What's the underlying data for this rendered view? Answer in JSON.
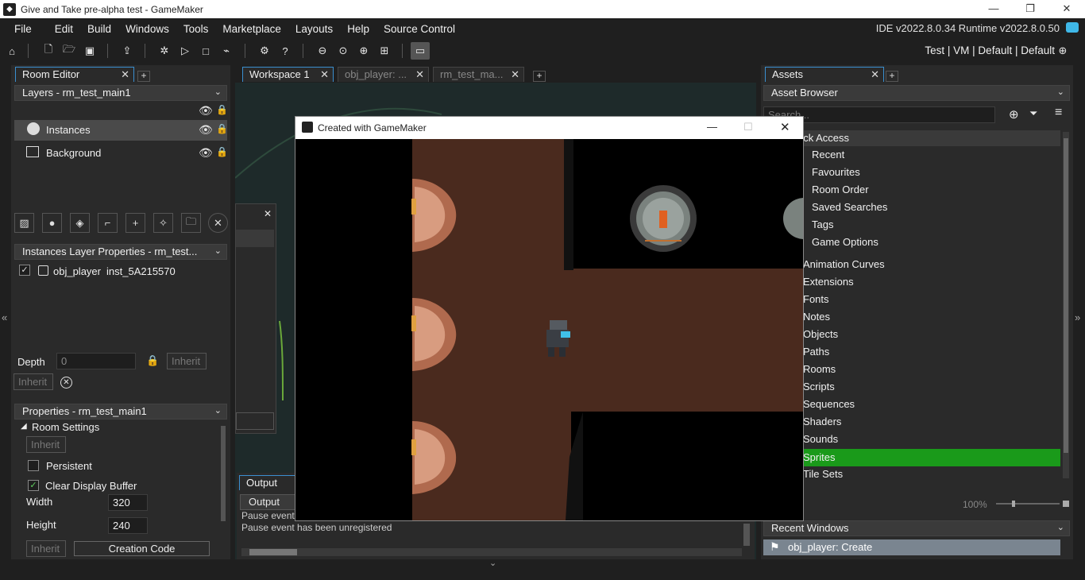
{
  "window": {
    "title": "Give and Take pre-alpha test - GameMaker",
    "min": "—",
    "max": "❐",
    "close": "✕"
  },
  "menu": [
    "File",
    "Edit",
    "Build",
    "Windows",
    "Tools",
    "Marketplace",
    "Layouts",
    "Help",
    "Source Control"
  ],
  "version": "IDE v2022.8.0.34  Runtime v2022.8.0.50",
  "target_config": "Test | VM | Default | Default",
  "room_editor": {
    "tab": "Room Editor",
    "layers_header": "Layers - rm_test_main1",
    "layers": [
      {
        "name": "Instances"
      },
      {
        "name": "Background"
      }
    ],
    "instances_header": "Instances Layer Properties - rm_test...",
    "instance": {
      "object": "obj_player",
      "id": "inst_5A215570"
    },
    "depth_label": "Depth",
    "depth_value": "0",
    "inherit": "Inherit"
  },
  "properties": {
    "header": "Properties - rm_test_main1",
    "section": "Room Settings",
    "inherit": "Inherit",
    "persistent": "Persistent",
    "clear_display_buffer": "Clear Display Buffer",
    "width_label": "Width",
    "width_value": "320",
    "height_label": "Height",
    "height_value": "240",
    "creation_code": "Creation Code"
  },
  "workspace_tabs": [
    "Workspace 1",
    "obj_player: ...",
    "rm_test_ma..."
  ],
  "output": {
    "tab": "Output",
    "subtab": "Output",
    "lines": [
      "Pause event",
      "Pause event has been unregistered"
    ]
  },
  "game_window": {
    "title": "Created with GameMaker",
    "min": "—",
    "max": "☐",
    "close": "✕"
  },
  "assets": {
    "tab": "Assets",
    "browser": "Asset Browser",
    "search_placeholder": "Search...",
    "quick_access": "Quick Access",
    "quick_items": [
      "Recent",
      "Favourites",
      "Room Order",
      "Saved Searches",
      "Tags",
      "Game Options"
    ],
    "groups": [
      "Animation Curves",
      "Extensions",
      "Fonts",
      "Notes",
      "Objects",
      "Paths",
      "Rooms",
      "Scripts",
      "Sequences",
      "Shaders",
      "Sounds",
      "Sprites",
      "Tile Sets"
    ],
    "selected_group": "Sprites",
    "zoom": "100%"
  },
  "recent_windows": {
    "header": "Recent Windows",
    "item": "obj_player: Create"
  },
  "colors": {
    "accent": "#3a8fd0",
    "selected_asset": "#1a9a1a",
    "check": "#5fcf5f"
  }
}
